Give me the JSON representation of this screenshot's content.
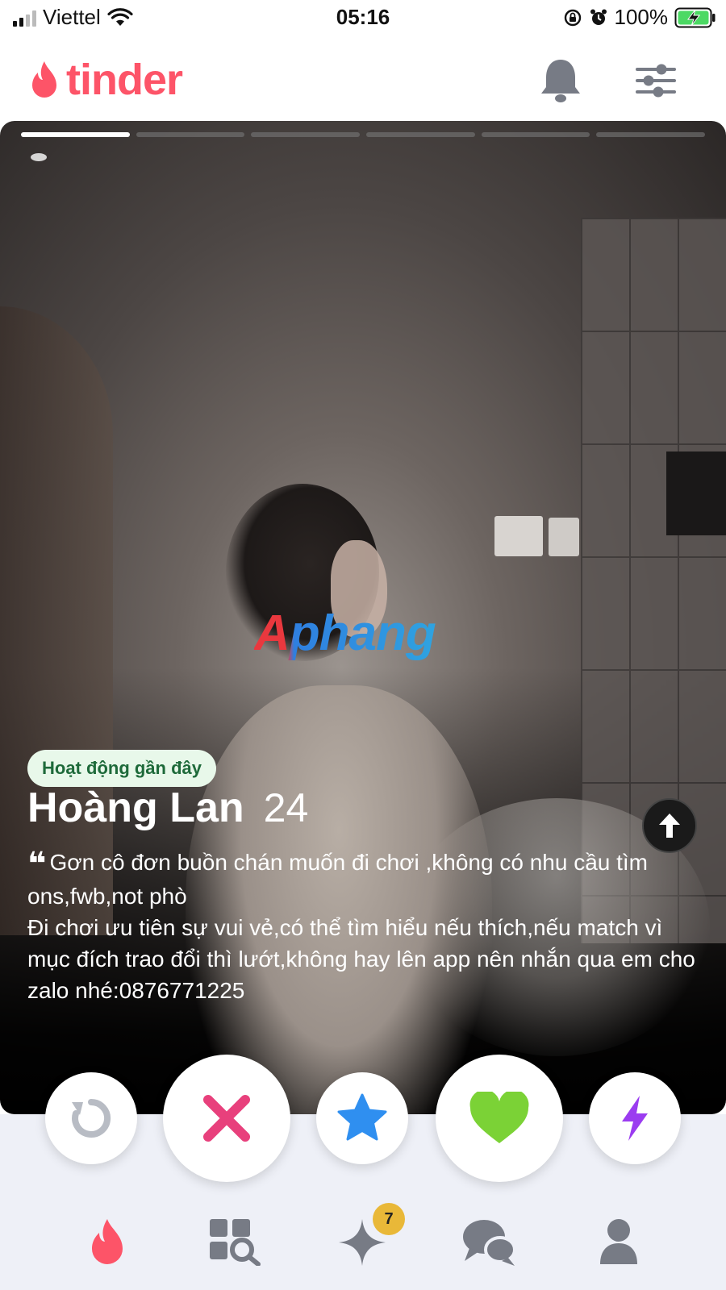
{
  "status_bar": {
    "carrier": "Viettel",
    "time": "05:16",
    "battery": "100%"
  },
  "header": {
    "logo": "tinder",
    "icons": [
      "bell-icon",
      "filter-sliders-icon"
    ]
  },
  "profile": {
    "photo_count": 6,
    "active_photo": 1,
    "activity_badge": "Hoạt động gần đây",
    "name": "Hoàng Lan",
    "age": "24",
    "bio_line1": "Gơn cô đơn buồn chán muốn đi chơi ,không có nhu cầu tìm ons,fwb,not phò",
    "bio_line2": "Đi chơi ưu tiên sự vui vẻ,có thể tìm hiểu nếu thích,nếu match vì mục đích trao đổi thì lướt,không hay lên app nên nhắn qua em cho zalo nhé:0876771225",
    "watermark": "Aphang"
  },
  "actions": [
    "rewind-icon",
    "nope-x-icon",
    "super-like-star-icon",
    "like-heart-icon",
    "boost-bolt-icon"
  ],
  "bottom_nav": {
    "items": [
      "flame-icon",
      "explore-grid-icon",
      "sparkle-icon",
      "chat-icon",
      "profile-icon"
    ],
    "sparkle_badge": "7"
  },
  "colors": {
    "brand": "#fd5468",
    "nope": "#e8407c",
    "star": "#2f8ff0",
    "heart": "#7bd236",
    "boost": "#9b3cf0",
    "badge_bg": "#e8f8ea",
    "badge_text": "#1e6a3a"
  }
}
